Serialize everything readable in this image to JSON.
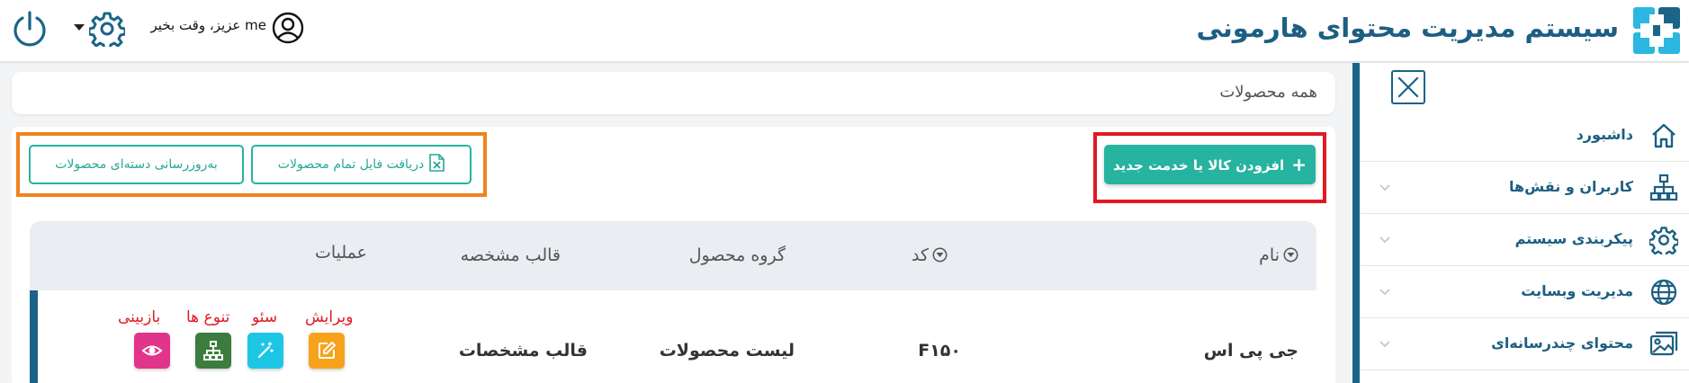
{
  "header": {
    "brand_title": "سیستم مدیریت محتوای هارمونی",
    "greeting": "me عزیز، وقت بخیر"
  },
  "sidebar": {
    "items": [
      {
        "label": "داشبورد",
        "icon": "home-icon",
        "has_submenu": false
      },
      {
        "label": "کاربران و نقش‌ها",
        "icon": "sitemap-icon",
        "has_submenu": true
      },
      {
        "label": "پیکربندی سیستم",
        "icon": "gear-icon",
        "has_submenu": true
      },
      {
        "label": "مدیریت وبسایت",
        "icon": "globe-icon",
        "has_submenu": true
      },
      {
        "label": "محتوای چندرسانه‌ای",
        "icon": "images-icon",
        "has_submenu": true
      }
    ]
  },
  "page": {
    "title": "همه محصولات"
  },
  "toolbar": {
    "add_label": "افزودن کالا یا خدمت جدید",
    "download_label": "دریافت فایل تمام محصولات",
    "update_label": "به‌روزرسانی دسته‌ای محصولات"
  },
  "table": {
    "columns": [
      "نام",
      "کد",
      "گروه محصول",
      "قالب مشخصه",
      "عملیات"
    ],
    "rows": [
      {
        "name": "جی پی اس",
        "code": "F۱۵۰",
        "group": "لیست محصولات",
        "template": "قالب مشخصات"
      }
    ]
  },
  "actions": {
    "edit": "ویرایش",
    "seo": "سئو",
    "variants": "تنوع ها",
    "view": "بازبینی"
  },
  "colors": {
    "primary": "#1a6488",
    "accent": "#26b39f",
    "highlight_red": "#e01a22",
    "highlight_orange": "#f0821e",
    "edit_button": "#f7a21b",
    "seo_button": "#1ec6e6",
    "variants_button": "#3d7c3f",
    "view_button": "#e0358a"
  }
}
